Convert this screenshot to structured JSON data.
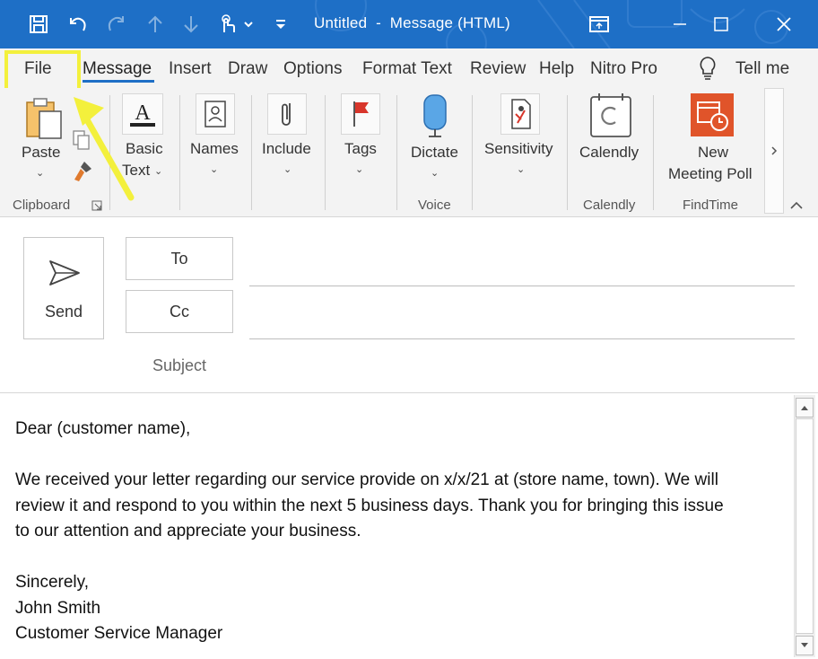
{
  "window": {
    "title": "Untitled  -  Message (HTML)",
    "accent": "#1e6fc6",
    "quick_access_icons": [
      "save-icon",
      "undo-icon",
      "redo-icon",
      "up-icon",
      "down-icon",
      "touch-mode-icon",
      "customize-qat-icon"
    ],
    "controls": [
      "ribbon-display-icon",
      "minimize-icon",
      "maximize-icon",
      "close-icon"
    ]
  },
  "menu": {
    "tabs": [
      "File",
      "Message",
      "Insert",
      "Draw",
      "Options",
      "Format Text",
      "Review",
      "Help",
      "Nitro Pro"
    ],
    "active_tab": "Message",
    "tell_me": "Tell me",
    "highlight_color": "#f3f03c"
  },
  "ribbon": {
    "paste": "Paste",
    "clipboard_group": "Clipboard",
    "basic_text": [
      "Basic",
      "Text"
    ],
    "names": "Names",
    "include": "Include",
    "tags": "Tags",
    "dictate": "Dictate",
    "voice_group": "Voice",
    "sensitivity": "Sensitivity",
    "calendly": "Calendly",
    "calendly_group": "Calendly",
    "new_meeting_poll": [
      "New",
      "Meeting Poll"
    ],
    "findtime_group": "FindTime"
  },
  "compose": {
    "send": "Send",
    "to": "To",
    "cc": "Cc",
    "subject": "Subject"
  },
  "body": {
    "greeting": "Dear (customer name),",
    "paragraph_lines": [
      "We received your letter regarding our service provide on x/x/21 at (store name, town). We will",
      "review it and respond to you within the next 5 business days. Thank you for bringing this issue",
      "to our attention and appreciate your business."
    ],
    "closing": "Sincerely,",
    "name": "John Smith",
    "role": "Customer Service Manager"
  }
}
